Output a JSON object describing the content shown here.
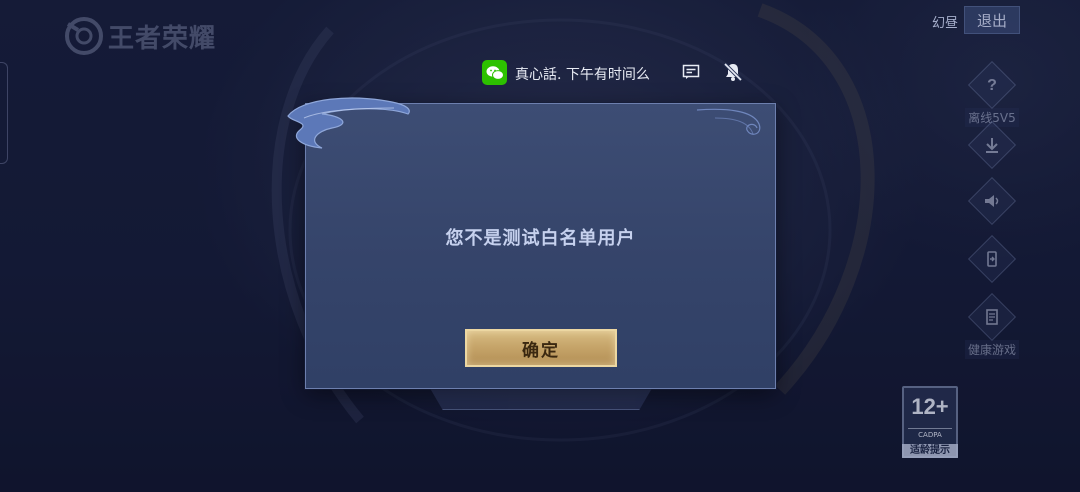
{
  "header": {
    "logo_text": "王者荣耀",
    "top_right_label": "幻昼",
    "exit_label": "退出"
  },
  "side_menu": {
    "items": [
      {
        "icon": "question-icon",
        "label": "离线5V5"
      },
      {
        "icon": "download-icon",
        "label": ""
      },
      {
        "icon": "speaker-icon",
        "label": ""
      },
      {
        "icon": "phone-switch-icon",
        "label": ""
      },
      {
        "icon": "notice-icon",
        "label": "健康游戏"
      }
    ]
  },
  "age_rating": {
    "age": "12+",
    "org": "CADPA",
    "tip": "适龄提示"
  },
  "notification": {
    "app_icon": "wechat-icon",
    "text": "真心話. 下午有时间么",
    "actions": [
      "message-icon",
      "mute-bell-icon"
    ]
  },
  "dialog": {
    "message": "您不是测试白名单用户",
    "confirm_label": "确定"
  },
  "colors": {
    "dialog_bg": "#3a4970",
    "dialog_border": "#6d7fae",
    "button_gold": "#c6a56a",
    "wechat_green": "#2dc100"
  }
}
